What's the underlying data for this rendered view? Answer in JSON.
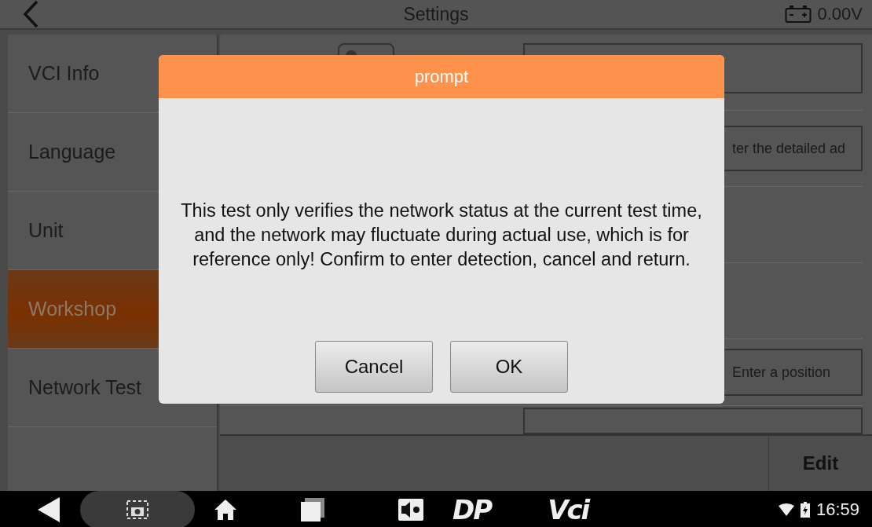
{
  "header": {
    "title": "Settings",
    "voltage": "0.00V"
  },
  "sidebar": {
    "items": [
      {
        "label": "VCI Info",
        "selected": false
      },
      {
        "label": "Language",
        "selected": false
      },
      {
        "label": "Unit",
        "selected": false
      },
      {
        "label": "Workshop",
        "selected": true
      },
      {
        "label": "Network Test",
        "selected": false
      }
    ]
  },
  "form": {
    "toggle": {
      "on": false
    },
    "fields": [
      {
        "placeholder": "ter the detailed ad"
      },
      {
        "placeholder": "Enter a position"
      }
    ],
    "edit_button": "Edit"
  },
  "dialog": {
    "title": "prompt",
    "message": "This test only verifies the network status at the current test time, and the network may fluctuate during actual use, which is for reference only! Confirm to enter detection, cancel and return.",
    "buttons": [
      "Cancel",
      "OK"
    ]
  },
  "navbar": {
    "logos": [
      "DP",
      "Vci"
    ],
    "time": "16:59"
  }
}
